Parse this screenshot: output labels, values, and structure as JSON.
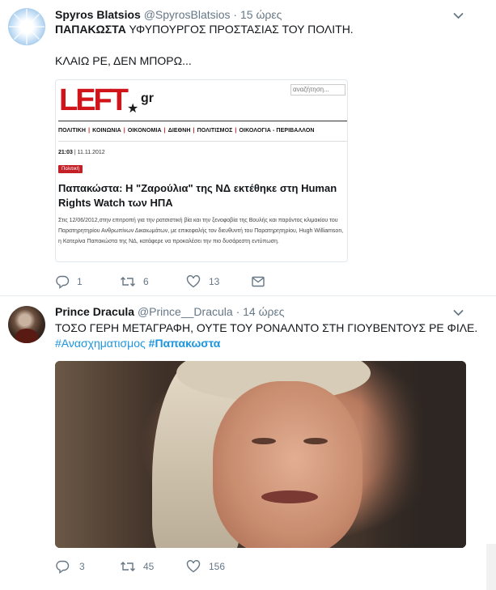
{
  "tweet1": {
    "display_name": "Spyros Blatsios",
    "handle": "@SpyrosBlatsios",
    "separator": "·",
    "time": "15 ώρες",
    "text_bold": "ΠΑΠΑΚΩΣΤΑ",
    "text_rest": " ΥΦΥΠΟΥΡΓΟΣ ΠΡΟΣΤΑΣΙΑΣ ΤΟΥ ΠΟΛΙΤΗ.",
    "text_line2": "ΚΛΑΙΩ ΡΕ, ΔΕΝ ΜΠΟΡΩ...",
    "card": {
      "logo_text": "LEFT",
      "logo_suffix": "gr",
      "logo_star": "★",
      "search_placeholder": "αναζήτηση...",
      "nav": [
        "ΠΟΛΙΤΙΚΗ",
        "ΚΟΙΝΩΝΙΑ",
        "ΟΙΚΟΝΟΜΙΑ",
        "ΔΙΕΘΝΗ",
        "ΠΟΛΙΤΙΣΜΟΣ",
        "ΟΙΚΟΛΟΓΙΑ - ΠΕΡΙΒΑΛΛΟΝ"
      ],
      "nav_separator": "|",
      "time": "21:03",
      "time_sep": "|",
      "date": "11.11.2012",
      "category": "Πολιτική",
      "headline": "Παπακώστα: Η \"Ζαρούλια\" της ΝΔ εκτέθηκε στη Human Rights Watch των ΗΠΑ",
      "body": "Στις 12/06/2012,στην επιτροπή για την ρατσιστική βία και την ξενοφοβία της Βουλής και παρόντος κλιμακίου του Παρατηρητηρίου Ανθρωπίνων Δικαιωμάτων, με επικεφαλής τον διευθυντή του Παρατηρητηρίου, Hugh Williamson, η Κατερίνα Παπακώστα της ΝΔ, κατάφερε να προκαλέσει την πιο δυσάρεστη εντύπωση."
    },
    "actions": {
      "replies": "1",
      "retweets": "6",
      "likes": "13"
    }
  },
  "tweet2": {
    "display_name": "Prince Dracula",
    "handle": "@Prince__Dracula",
    "separator": "·",
    "time": "14 ώρες",
    "text": "ΤΟΣΟ ΓΕΡΗ ΜΕΤΑΓΡΑΦΗ, ΟΥΤΕ ΤΟΥ ΡΟΝΑΛΝΤΟ ΣΤΗ ΓΙΟΥΒΕΝΤΟΥΣ ΡΕ ΦΙΛΕ.",
    "hashtag1": "#Ανασχηματισμος",
    "hashtag2": "#Παπακωστα",
    "actions": {
      "replies": "3",
      "retweets": "45",
      "likes": "156"
    }
  },
  "colors": {
    "link": "#1b95e0",
    "muted": "#657786",
    "brand_red": "#d0141a"
  },
  "icons": [
    "reply-icon",
    "retweet-icon",
    "like-icon",
    "message-icon",
    "caret-down-icon"
  ]
}
